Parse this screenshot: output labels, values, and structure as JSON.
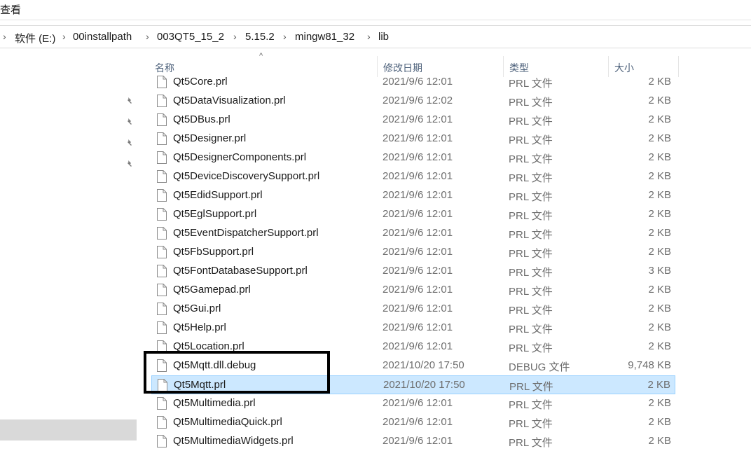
{
  "menu": {
    "view_label": "查看"
  },
  "breadcrumb": [
    "软件 (E:)",
    "00installpath",
    "003QT5_15_2",
    "5.15.2",
    "mingw81_32",
    "lib"
  ],
  "columns": {
    "name": "名称",
    "date": "修改日期",
    "type": "类型",
    "size": "大小"
  },
  "files": [
    {
      "name": "Qt5Core.prl",
      "date": "2021/9/6 12:01",
      "type": "PRL 文件",
      "size": "2 KB"
    },
    {
      "name": "Qt5DataVisualization.prl",
      "date": "2021/9/6 12:02",
      "type": "PRL 文件",
      "size": "2 KB"
    },
    {
      "name": "Qt5DBus.prl",
      "date": "2021/9/6 12:01",
      "type": "PRL 文件",
      "size": "2 KB"
    },
    {
      "name": "Qt5Designer.prl",
      "date": "2021/9/6 12:01",
      "type": "PRL 文件",
      "size": "2 KB"
    },
    {
      "name": "Qt5DesignerComponents.prl",
      "date": "2021/9/6 12:01",
      "type": "PRL 文件",
      "size": "2 KB"
    },
    {
      "name": "Qt5DeviceDiscoverySupport.prl",
      "date": "2021/9/6 12:01",
      "type": "PRL 文件",
      "size": "2 KB"
    },
    {
      "name": "Qt5EdidSupport.prl",
      "date": "2021/9/6 12:01",
      "type": "PRL 文件",
      "size": "2 KB"
    },
    {
      "name": "Qt5EglSupport.prl",
      "date": "2021/9/6 12:01",
      "type": "PRL 文件",
      "size": "2 KB"
    },
    {
      "name": "Qt5EventDispatcherSupport.prl",
      "date": "2021/9/6 12:01",
      "type": "PRL 文件",
      "size": "2 KB"
    },
    {
      "name": "Qt5FbSupport.prl",
      "date": "2021/9/6 12:01",
      "type": "PRL 文件",
      "size": "2 KB"
    },
    {
      "name": "Qt5FontDatabaseSupport.prl",
      "date": "2021/9/6 12:01",
      "type": "PRL 文件",
      "size": "3 KB"
    },
    {
      "name": "Qt5Gamepad.prl",
      "date": "2021/9/6 12:01",
      "type": "PRL 文件",
      "size": "2 KB"
    },
    {
      "name": "Qt5Gui.prl",
      "date": "2021/9/6 12:01",
      "type": "PRL 文件",
      "size": "2 KB"
    },
    {
      "name": "Qt5Help.prl",
      "date": "2021/9/6 12:01",
      "type": "PRL 文件",
      "size": "2 KB"
    },
    {
      "name": "Qt5Location.prl",
      "date": "2021/9/6 12:01",
      "type": "PRL 文件",
      "size": "2 KB"
    },
    {
      "name": "Qt5Mqtt.dll.debug",
      "date": "2021/10/20 17:50",
      "type": "DEBUG 文件",
      "size": "9,748 KB"
    },
    {
      "name": "Qt5Mqtt.prl",
      "date": "2021/10/20 17:50",
      "type": "PRL 文件",
      "size": "2 KB",
      "selected": true
    },
    {
      "name": "Qt5Multimedia.prl",
      "date": "2021/9/6 12:01",
      "type": "PRL 文件",
      "size": "2 KB"
    },
    {
      "name": "Qt5MultimediaQuick.prl",
      "date": "2021/9/6 12:01",
      "type": "PRL 文件",
      "size": "2 KB"
    },
    {
      "name": "Qt5MultimediaWidgets.prl",
      "date": "2021/9/6 12:01",
      "type": "PRL 文件",
      "size": "2 KB"
    }
  ],
  "colors": {
    "selection_bg": "#cce8ff",
    "selection_border": "#99d1ff",
    "header_text": "#4c607a"
  },
  "icons": {
    "file": "file-icon",
    "pin": "pin-icon",
    "chevron": "chevron-right-icon"
  }
}
